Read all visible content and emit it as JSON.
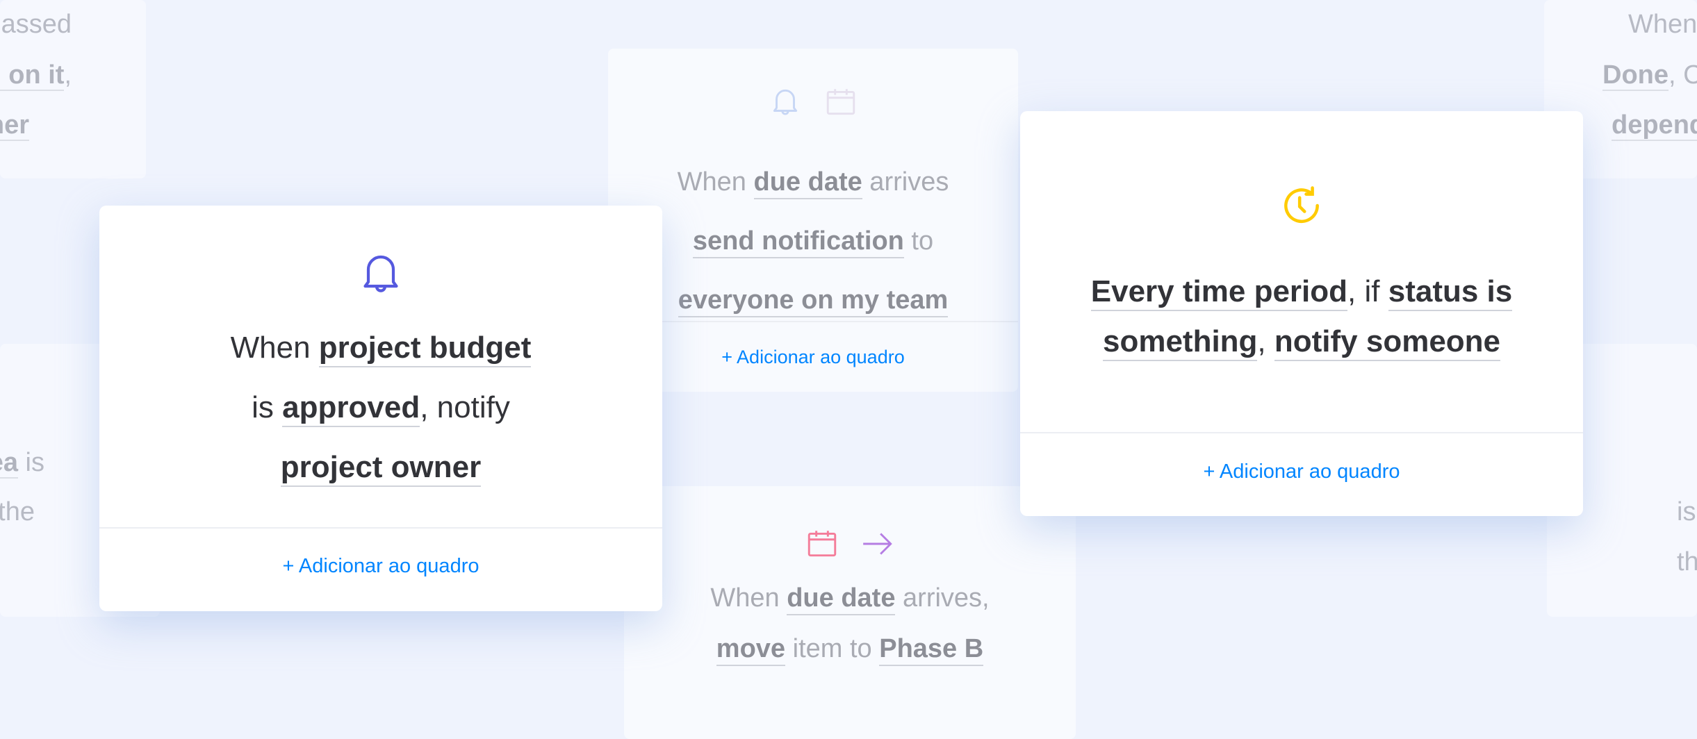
{
  "colors": {
    "background": "#eff3fd",
    "link": "#0085ff",
    "text": "#323338",
    "bell": "#5559df",
    "clock": "#ffcb00",
    "calendar": "#f47d9a",
    "arrow": "#b57de3"
  },
  "background_fragments": {
    "left_top": [
      {
        "text": "assed",
        "bold": false
      },
      {
        "text": "g on it",
        "bold": true,
        "suffix": ","
      },
      {
        "text": "ner",
        "bold": true
      }
    ],
    "left_mid": [
      {
        "text": "ea",
        "bold": true,
        "suffix": " is"
      },
      {
        "text": "the",
        "bold": false
      }
    ],
    "right_top": [
      {
        "text": "When",
        "bold": false
      },
      {
        "text": "Done",
        "bold": true,
        "suffix": ", C"
      },
      {
        "text": "depend",
        "bold": true
      }
    ],
    "right_mid": [
      {
        "text": "is",
        "bold": false
      },
      {
        "text": "th",
        "bold": false
      }
    ]
  },
  "cards": [
    {
      "id": "budget",
      "icons": [
        "bell-icon"
      ],
      "lines": [
        [
          {
            "text": "When ",
            "bold": false
          },
          {
            "text": "project budget",
            "bold": true
          }
        ],
        [
          {
            "text": "is ",
            "bold": false
          },
          {
            "text": "approved",
            "bold": true
          },
          {
            "text": ", notify",
            "bold": false
          }
        ],
        [
          {
            "text": "project owner",
            "bold": true
          }
        ]
      ],
      "link": "+ Adicionar ao quadro"
    },
    {
      "id": "recurring",
      "icons": [
        "clock-repeat-icon"
      ],
      "lines": [
        [
          {
            "text": "Every time period",
            "bold": true
          },
          {
            "text": ", if ",
            "bold": false
          },
          {
            "text": "status is",
            "bold": true
          }
        ],
        [
          {
            "text": "something",
            "bold": true
          },
          {
            "text": ", ",
            "bold": false
          },
          {
            "text": "notify someone",
            "bold": true
          }
        ]
      ],
      "link": "+ Adicionar ao quadro"
    },
    {
      "id": "due-notify",
      "icons": [
        "bell-icon",
        "calendar-icon"
      ],
      "lines": [
        [
          {
            "text": "When ",
            "bold": false
          },
          {
            "text": "due date",
            "bold": true
          },
          {
            "text": " arrives",
            "bold": false
          }
        ],
        [
          {
            "text": "send notification",
            "bold": true
          },
          {
            "text": " to",
            "bold": false
          }
        ],
        [
          {
            "text": "everyone on my team",
            "bold": true
          }
        ]
      ],
      "link": "+ Adicionar ao quadro"
    },
    {
      "id": "due-move",
      "icons": [
        "calendar-icon",
        "arrow-right-icon"
      ],
      "lines": [
        [
          {
            "text": "When ",
            "bold": false
          },
          {
            "text": "due date",
            "bold": true
          },
          {
            "text": " arrives,",
            "bold": false
          }
        ],
        [
          {
            "text": "move",
            "bold": true
          },
          {
            "text": " item to ",
            "bold": false
          },
          {
            "text": "Phase B",
            "bold": true
          }
        ]
      ]
    }
  ]
}
